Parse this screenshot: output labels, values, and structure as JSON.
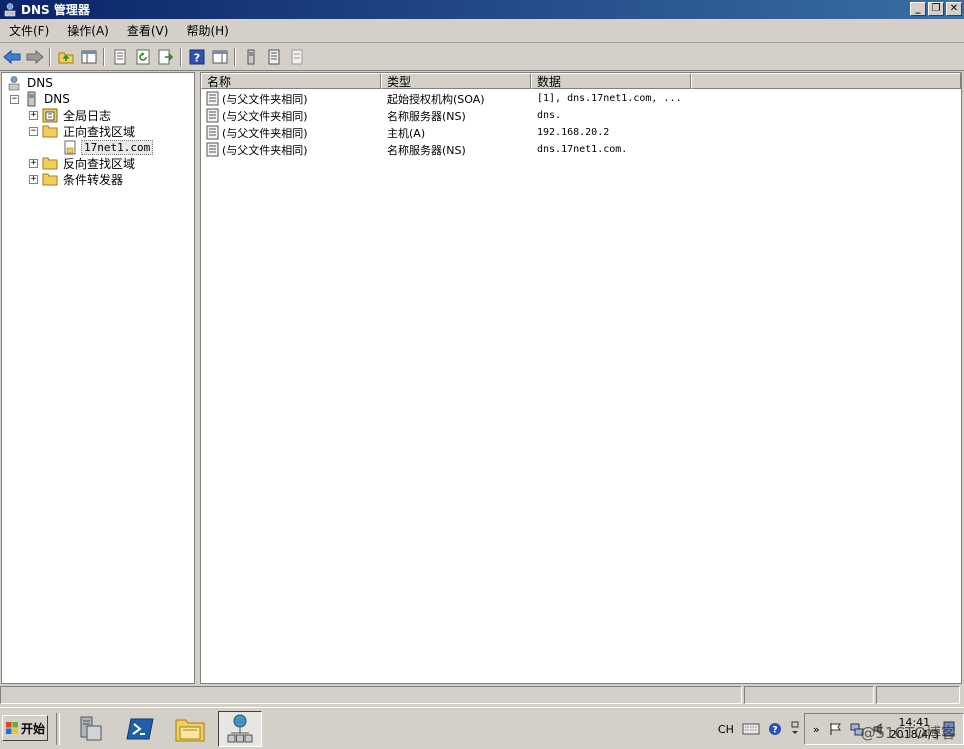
{
  "window": {
    "title": "DNS 管理器"
  },
  "window_buttons": {
    "minimize": "_",
    "restore": "❐",
    "close": "✕"
  },
  "menu": [
    {
      "label": "文件(F)"
    },
    {
      "label": "操作(A)"
    },
    {
      "label": "查看(V)"
    },
    {
      "label": "帮助(H)"
    }
  ],
  "toolbar": {
    "buttons": [
      "back-icon",
      "forward-icon",
      "up-folder-icon",
      "show-hide-tree-icon",
      "properties-icon",
      "refresh-icon",
      "export-list-icon",
      "help-icon",
      "action-pane-icon",
      "server-icon",
      "record-icon",
      "delete-record-icon"
    ]
  },
  "tree": {
    "root": "DNS",
    "server": "DNS",
    "global_logs": "全局日志",
    "forward_zones": "正向查找区域",
    "zone": "17net1.com",
    "reverse_zones": "反向查找区域",
    "conditional_forwarders": "条件转发器",
    "expand_plus": "+",
    "collapse_minus": "−"
  },
  "list": {
    "columns": [
      "名称",
      "类型",
      "数据"
    ],
    "rows": [
      {
        "name": "(与父文件夹相同)",
        "type": "起始授权机构(SOA)",
        "data": "[1], dns.17net1.com, ..."
      },
      {
        "name": "(与父文件夹相同)",
        "type": "名称服务器(NS)",
        "data": "dns."
      },
      {
        "name": "(与父文件夹相同)",
        "type": "主机(A)",
        "data": "192.168.20.2"
      },
      {
        "name": "(与父文件夹相同)",
        "type": "名称服务器(NS)",
        "data": "dns.17net1.com."
      }
    ]
  },
  "taskbar": {
    "start_label": "开始",
    "lang": "CH",
    "tray_expand": "»",
    "clock_time": "14:41",
    "clock_date": "2018/4/3",
    "watermark": "@51CTO博客"
  },
  "colors": {
    "titlebar_start": "#0a246a",
    "titlebar_end": "#3a6ea5",
    "face": "#d4d0c8"
  }
}
